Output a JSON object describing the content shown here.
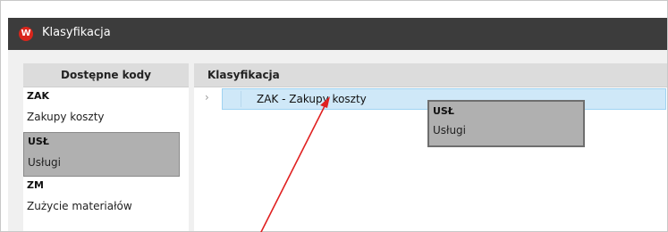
{
  "window": {
    "title": "Klasyfikacja",
    "icon_letter": "W"
  },
  "available_codes": {
    "header": "Dostępne kody",
    "items": [
      {
        "code": "ZAK",
        "name": "Zakupy koszty",
        "selected": false
      },
      {
        "code": "USŁ",
        "name": "Usługi",
        "selected": true
      },
      {
        "code": "ZM",
        "name": "Zużycie materiałów",
        "selected": false
      }
    ]
  },
  "classification": {
    "header": "Klasyfikacja",
    "expander": "›",
    "node": {
      "label": "ZAK - Zakupy koszty"
    }
  },
  "drag_preview": {
    "code": "USŁ",
    "name": "Usługi"
  },
  "colors": {
    "titlebar": "#3c3c3c",
    "selection": "#b0b0b0",
    "node_highlight": "#cfe8f8",
    "arrow": "#e02020"
  }
}
